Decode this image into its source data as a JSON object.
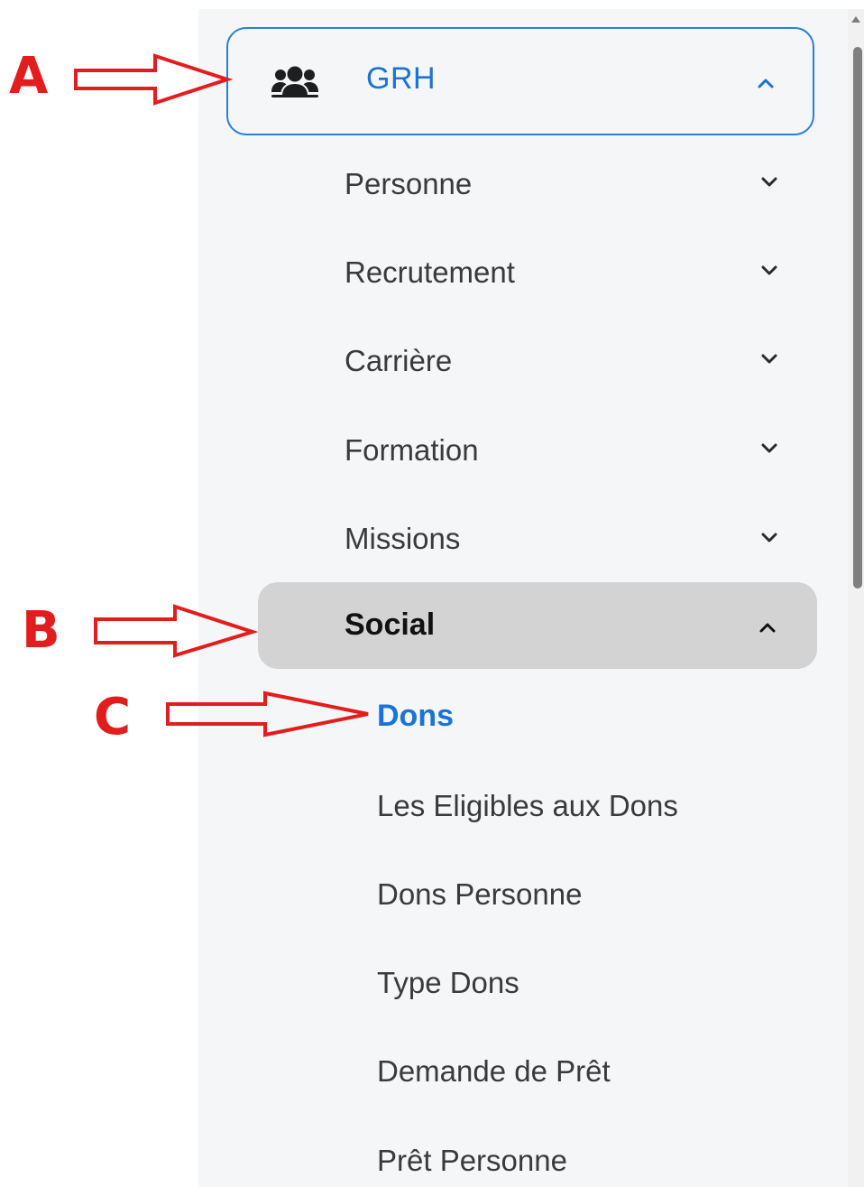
{
  "annotations": {
    "a": "A",
    "b": "B",
    "c": "C"
  },
  "grh": {
    "label": "GRH",
    "icon": "users-icon",
    "expanded": true
  },
  "menu": [
    {
      "label": "Personne"
    },
    {
      "label": "Recrutement"
    },
    {
      "label": "Carrière"
    },
    {
      "label": "Formation"
    },
    {
      "label": "Missions"
    }
  ],
  "social": {
    "label": "Social",
    "expanded": true
  },
  "dons": {
    "label": "Dons"
  },
  "dons_items": [
    {
      "label": "Les Eligibles aux Dons"
    },
    {
      "label": "Dons Personne"
    },
    {
      "label": "Type Dons"
    },
    {
      "label": "Demande de Prêt"
    },
    {
      "label": "Prêt Personne"
    }
  ],
  "colors": {
    "accent": "#1a73d9",
    "annotation": "#e21d1d",
    "selected_bg": "#d3d3d3",
    "sidebar_bg": "#f5f6f8"
  }
}
